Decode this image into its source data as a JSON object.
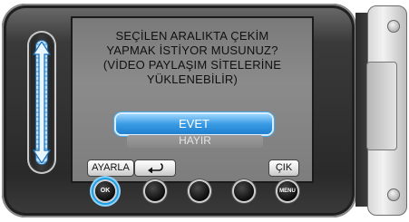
{
  "dialog": {
    "message": "SEÇİLEN ARALIKTA ÇEKİM\nYAPMAK İSTİYOR MUSUNUZ?\n(VİDEO PAYLAŞIM SİTELERİNE\nYÜKLENEBİLİR)",
    "options": [
      {
        "label": "EVET",
        "selected": true
      },
      {
        "label": "HAYIR",
        "selected": false
      }
    ]
  },
  "softkeys": {
    "set_label": "AYARLA",
    "back_icon": "return-arrow-icon",
    "quit_label": "ÇIK"
  },
  "buttons": {
    "ok_label": "OK",
    "menu_label": "MENU"
  },
  "colors": {
    "highlight": "#3a9be4",
    "active_ring": "#1b9fe6"
  }
}
